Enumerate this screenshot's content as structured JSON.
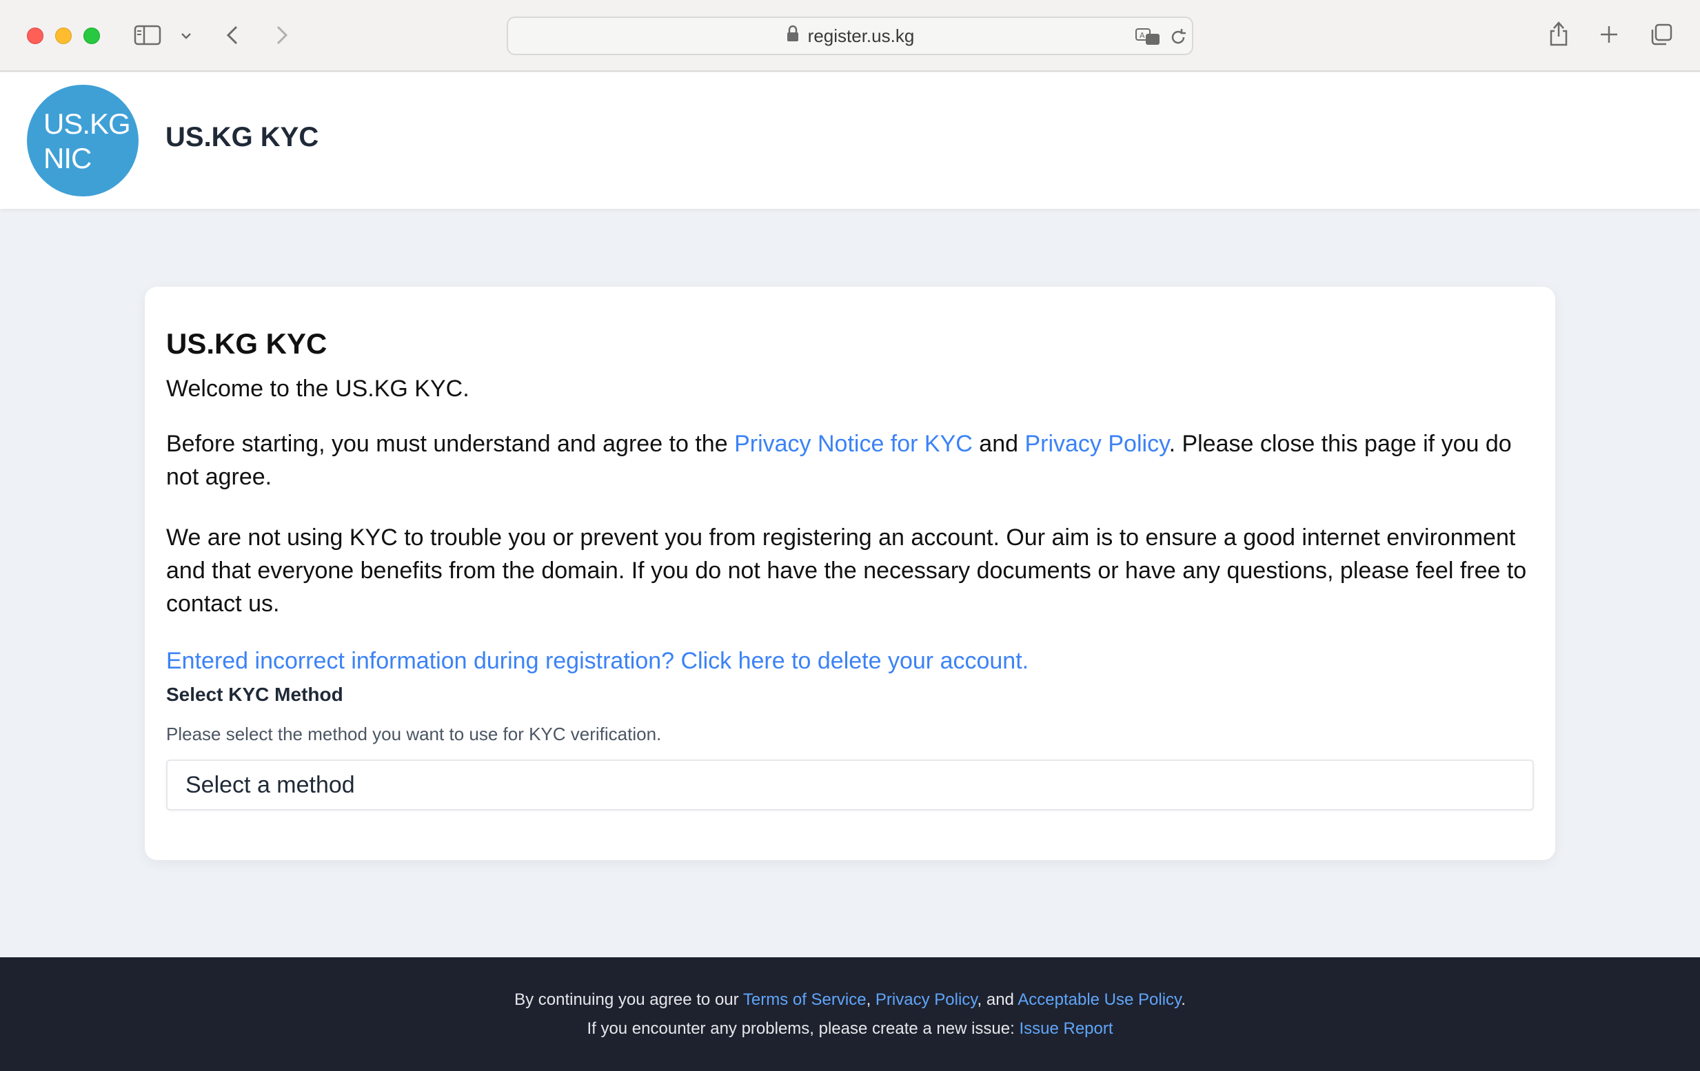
{
  "browser": {
    "url": "register.us.kg"
  },
  "header": {
    "logo_line1": "US.KG",
    "logo_line2": "NIC",
    "title": "US.KG KYC"
  },
  "card": {
    "title": "US.KG KYC",
    "welcome": "Welcome to the US.KG KYC.",
    "agree_before": "Before starting, you must understand and agree to the ",
    "privacy_notice_link": "Privacy Notice for KYC",
    "agree_and": " and ",
    "privacy_policy_link": "Privacy Policy",
    "agree_after": ". Please close this page if you do not agree.",
    "aim_text": "We are not using KYC to trouble you or prevent you from registering an account. Our aim is to ensure a good internet environment and that everyone benefits from the domain. If you do not have the necessary documents or have any questions, please feel free to contact us.",
    "delete_link": "Entered incorrect information during registration? Click here to delete your account.",
    "method_label": "Select KYC Method",
    "method_help": "Please select the method you want to use for KYC verification.",
    "method_select_value": "Select a method"
  },
  "footer": {
    "line1_before": "By continuing you agree to our ",
    "terms_link": "Terms of Service",
    "comma": ", ",
    "privacy_link": "Privacy Policy",
    "and": ", and ",
    "aup_link": "Acceptable Use Policy",
    "period": ".",
    "line2_before": "If you encounter any problems, please create a new issue: ",
    "issue_link": "Issue Report"
  },
  "colors": {
    "logo": "#3fa0d6",
    "link": "#3b82f6",
    "footer_bg": "#1e222e"
  }
}
